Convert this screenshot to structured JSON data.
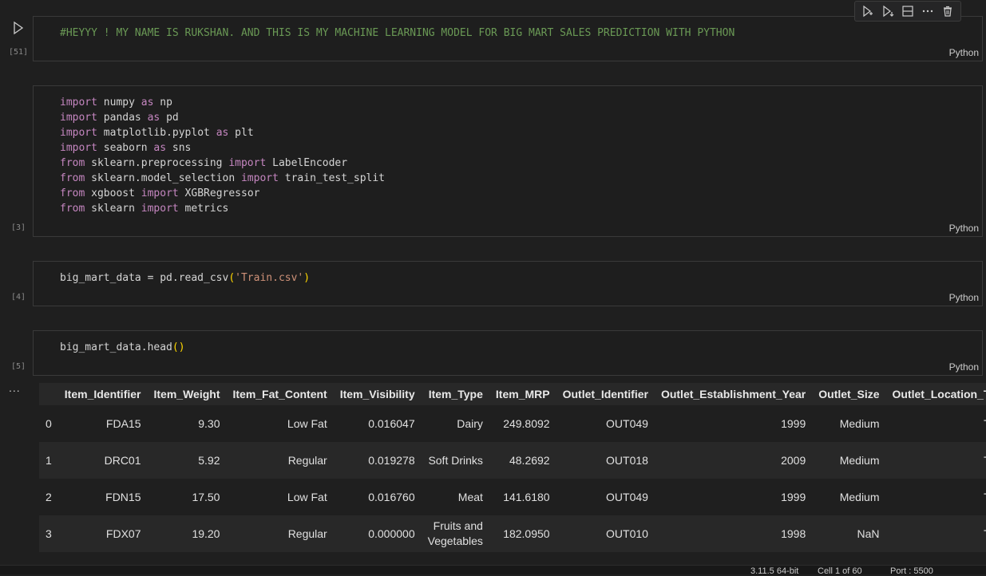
{
  "toolbar": {
    "items": [
      "run-by-line",
      "execute-below",
      "split-cell",
      "more-actions",
      "delete-cell"
    ]
  },
  "cells": [
    {
      "exec_count": "[51]",
      "lang": "Python",
      "comment": "#HEYYY ! MY NAME IS RUKSHAN. AND THIS IS MY MACHINE LEARNING MODEL FOR BIG MART SALES PREDICTION WITH PYTHON"
    },
    {
      "exec_count": "[3]",
      "lang": "Python",
      "lines": [
        {
          "kw1": "import",
          "a": " numpy ",
          "kw2": "as",
          "b": " np"
        },
        {
          "kw1": "import",
          "a": " pandas ",
          "kw2": "as",
          "b": " pd"
        },
        {
          "kw1": "import",
          "a": " matplotlib.pyplot ",
          "kw2": "as",
          "b": " plt"
        },
        {
          "kw1": "import",
          "a": " seaborn ",
          "kw2": "as",
          "b": " sns"
        },
        {
          "kw1": "from",
          "a": " sklearn.preprocessing ",
          "kw2": "import",
          "b": " LabelEncoder"
        },
        {
          "kw1": "from",
          "a": " sklearn.model_selection ",
          "kw2": "import",
          "b": " train_test_split"
        },
        {
          "kw1": "from",
          "a": " xgboost ",
          "kw2": "import",
          "b": " XGBRegressor"
        },
        {
          "kw1": "from",
          "a": " sklearn ",
          "kw2": "import",
          "b": " metrics"
        }
      ]
    },
    {
      "exec_count": "[4]",
      "lang": "Python",
      "pre": "big_mart_data = pd.read_csv",
      "open": "(",
      "str": "'Train.csv'",
      "close": ")"
    },
    {
      "exec_count": "[5]",
      "lang": "Python",
      "pre": "big_mart_data.head",
      "open": "(",
      "close": ")"
    }
  ],
  "output": {
    "more": "...",
    "columns": [
      "",
      "Item_Identifier",
      "Item_Weight",
      "Item_Fat_Content",
      "Item_Visibility",
      "Item_Type",
      "Item_MRP",
      "Outlet_Identifier",
      "Outlet_Establishment_Year",
      "Outlet_Size",
      "Outlet_Location_Typ"
    ],
    "rows": [
      [
        "0",
        "FDA15",
        "9.30",
        "Low Fat",
        "0.016047",
        "Dairy",
        "249.8092",
        "OUT049",
        "1999",
        "Medium",
        "Tier"
      ],
      [
        "1",
        "DRC01",
        "5.92",
        "Regular",
        "0.019278",
        "Soft Drinks",
        "48.2692",
        "OUT018",
        "2009",
        "Medium",
        "Tier"
      ],
      [
        "2",
        "FDN15",
        "17.50",
        "Low Fat",
        "0.016760",
        "Meat",
        "141.6180",
        "OUT049",
        "1999",
        "Medium",
        "Tier"
      ],
      [
        "3",
        "FDX07",
        "19.20",
        "Regular",
        "0.000000",
        "Fruits and Vegetables",
        "182.0950",
        "OUT010",
        "1998",
        "NaN",
        "Tier"
      ]
    ]
  },
  "status": {
    "python": "3.11.5 64-bit",
    "cell": "Cell 1 of 60",
    "port": "Port : 5500"
  }
}
